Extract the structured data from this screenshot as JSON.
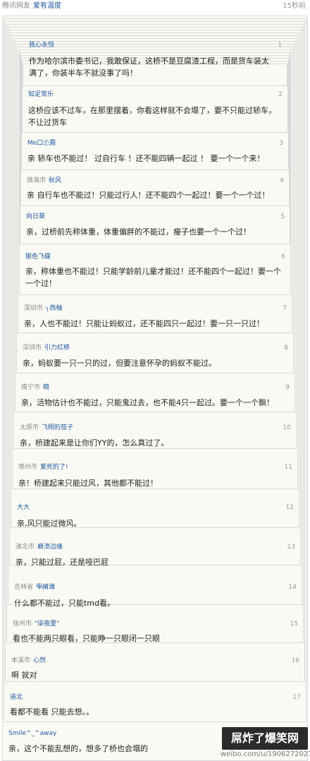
{
  "header": {
    "source": "腾讯网友",
    "user": "爱有温度",
    "time": "15秒前"
  },
  "floors": [
    {
      "num": "1",
      "loc": "",
      "name": "我心永恒",
      "text": "作为哈尔滨市委书记，我敢保证，这桥不是豆腐渣工程，而是货车装太满了，你装半车不就没事了吗！"
    },
    {
      "num": "2",
      "loc": "",
      "name": "知足常乐",
      "text": "这桥应该不过车，在那里摆着，你看这样就不会塌了，要不只能过轿车，不让过货车"
    },
    {
      "num": "3",
      "loc": "",
      "name": "Me口尐霞",
      "text": "亲 轿车也不能过！  过自行车 ！还不能四辆一起过 ！  要一个一个来！"
    },
    {
      "num": "4",
      "loc": "珠海市",
      "name": "秋风",
      "text": "亲 自行车也不能过！只能过行人！还不能四个一起过！要一个一个过！"
    },
    {
      "num": "5",
      "loc": "",
      "name": "向日葵",
      "text": "亲，过桥前先称体重，体重偏胖的不能过，瘦子也要一个一个过！"
    },
    {
      "num": "6",
      "loc": "",
      "name": "银色飞碟",
      "text": "亲，称体重也不能过！只能学龄前儿童才能过！还不能四个一起过！要一个一个过！"
    },
    {
      "num": "7",
      "loc": "深圳市",
      "name": "╮西柚",
      "text": "亲，人也不能过！只能让蚂蚁过，还不能四只一起过！要一只一只过！"
    },
    {
      "num": "8",
      "loc": "深圳市",
      "name": "引力红移",
      "text": "亲，蚂蚁要一只一只的过，但要注意怀孕的蚂蚁不能过。"
    },
    {
      "num": "9",
      "loc": "南宁市",
      "name": "曉",
      "text": "亲，活物估计也不能过，只能鬼过去，也不能4只一起过。要一个一个飘！"
    },
    {
      "num": "10",
      "loc": "太原市",
      "name": "飞翔的茄子",
      "text": "亲，桥建起来是让你们YY的，怎么真过了。"
    },
    {
      "num": "11",
      "loc": "亳州市",
      "name": "爱死的了!",
      "text": "亲！桥建起来只能过风，其他都不能过！"
    },
    {
      "num": "12",
      "loc": "",
      "name": "大大",
      "text": "亲,风只能过微风。"
    },
    {
      "num": "13",
      "loc": "淮北市",
      "name": "崩溃边缘",
      "text": "亲，只能过屁，还是哑巴屁"
    },
    {
      "num": "14",
      "loc": "吉林省",
      "name": "雫綪濰",
      "text": "什么都不能过，只能tmd看。"
    },
    {
      "num": "15",
      "loc": "徐州市",
      "name": "\"柒夜夏\"",
      "text": "看也不能两只眼看，只能睁一只眼闭一只眼"
    },
    {
      "num": "16",
      "loc": "本溪市",
      "name": "心然",
      "text": "啊 就对"
    },
    {
      "num": "17",
      "loc": "",
      "name": "道北",
      "text": "看都不能看 只能去想。。"
    },
    {
      "num": "",
      "loc": "",
      "name": "Smile^_^away",
      "text": "亲，这个不能乱想的，想多了桥也会塌的"
    }
  ],
  "watermark": {
    "title": "屌炸了爆笑网",
    "url": "weibo.com/u/1906272027"
  }
}
